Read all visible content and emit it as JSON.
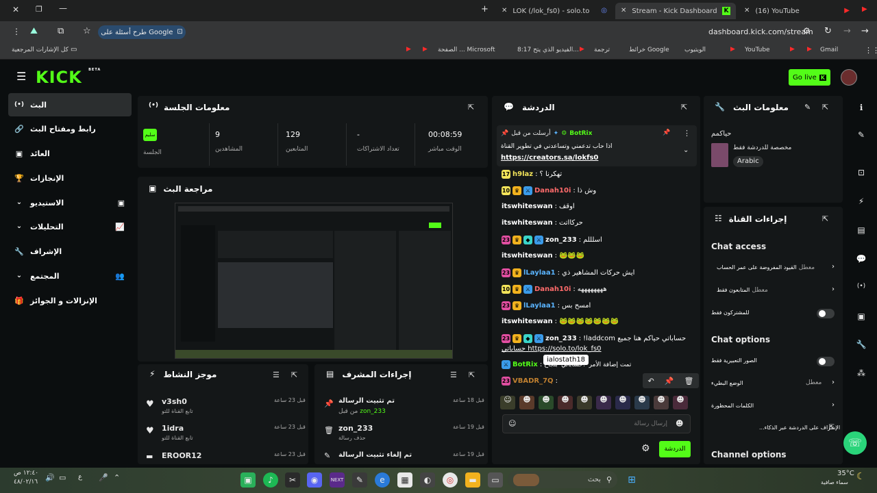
{
  "browser": {
    "tabs": [
      {
        "label": "LOK (/lok_fs0) - solo.to"
      },
      {
        "label": "Stream - Kick Dashboard"
      },
      {
        "label": "(16) YouTube"
      }
    ],
    "url": "dashboard.kick.com/stream",
    "search_pill": "طرح أسئلة على Google",
    "bookmarks": [
      "Gmail",
      "YouTube",
      "الويتيوب",
      "خرائط Google",
      "ترجمة",
      "8:17 الفيديو الذي يتح...",
      "الصفحة ... Microsoft",
      "كل الإشارات المرجعية"
    ]
  },
  "header": {
    "logo": "KICK",
    "logo_badge": "BETA",
    "go_live": "Go live"
  },
  "nav": {
    "items": [
      {
        "label": "البث"
      },
      {
        "label": "رابط ومفتاح البث"
      },
      {
        "label": "العائد"
      },
      {
        "label": "الإنجازات"
      },
      {
        "label": "الاستيديو"
      },
      {
        "label": "التحليلات"
      },
      {
        "label": "الإشراف"
      },
      {
        "label": "المجتمع"
      },
      {
        "label": "الإنزالات و الجوائز"
      }
    ]
  },
  "session": {
    "title": "معلومات الجلسة",
    "health_label": "سليم",
    "health_sub": "الجلسة",
    "stats": [
      {
        "value": "9",
        "label": "المشاهدين"
      },
      {
        "value": "129",
        "label": "المتابعين"
      },
      {
        "value": "-",
        "label": "تعداد الاشتراكات"
      },
      {
        "value": "00:08:59",
        "label": "الوقت مباشر"
      }
    ]
  },
  "preview": {
    "title": "مراجعة البث"
  },
  "activity": {
    "title": "موجز النشاط",
    "items": [
      {
        "user": "v3sh0",
        "action": "تابع القناة للتو",
        "time": "قبل 23 ساعة"
      },
      {
        "user": "1idra",
        "action": "تابع القناة للتو",
        "time": "قبل 23 ساعة"
      },
      {
        "user": "EROOR12",
        "action": "",
        "time": "قبل 23 ساعة"
      }
    ]
  },
  "modactions": {
    "title": "إجراءات المشرف",
    "items": [
      {
        "title": "تم تثبيت الرسالة",
        "sub_prefix": "من قبل ",
        "sub_user": "zon_233",
        "time": "قبل 18 ساعة"
      },
      {
        "title": "zon_233",
        "sub_prefix": "حذف رسالة",
        "sub_user": "",
        "time": "قبل 19 ساعة"
      },
      {
        "title": "تم إلغاء تثبيت الرسالة",
        "sub_prefix": "",
        "sub_user": "",
        "time": "قبل 19 ساعة"
      }
    ]
  },
  "chat": {
    "title": "الدردشة",
    "pinned": {
      "by": "أرسلت من قبل",
      "user": "BotRix",
      "text": "اذا حاب تدعمني وتساعدني في تطوير القناة",
      "link": "https://creators.sa/lokfs0"
    },
    "messages": [
      {
        "user": "h9laz",
        "color": "#f2e35a",
        "text": "تهكرنا ؟"
      },
      {
        "user": "Danah10i",
        "color": "#ff6b6b",
        "text": "وش ذا"
      },
      {
        "user": "itswhiteswan",
        "color": "#ffffff",
        "text": "اوقف"
      },
      {
        "user": "itswhiteswan",
        "color": "#ffffff",
        "text": "حركااتت"
      },
      {
        "user": "zon_233",
        "color": "#ffffff",
        "text": "اسلللم"
      },
      {
        "user": "itswhiteswan",
        "color": "#ffffff",
        "text": "🐸🐸🐸"
      },
      {
        "user": "lLaylaa1",
        "color": "#5ab4ff",
        "text": "ايش حركات المشاهير ذي"
      },
      {
        "user": "Danah10i",
        "color": "#ff6b6b",
        "text": "ههههههههه"
      },
      {
        "user": "lLaylaa1",
        "color": "#5ab4ff",
        "text": "امسح بس"
      },
      {
        "user": "itswhiteswan",
        "color": "#ffffff",
        "text": "🐸🐸🐸🐸🐸🐸🐸"
      },
      {
        "user": "zon_233",
        "color": "#ffffff",
        "text": "!laddcom حساباتي حياكم هنا جميع"
      },
      {
        "user": "",
        "color": "#ffffff",
        "text": "حساباتي https://solo.to/lok_fs0"
      },
      {
        "user": "BotRix",
        "color": "#5aff6a",
        "text": "تمت إضافة الأمر '!حساباتي' بنجاح"
      },
      {
        "user": "VBADR_7Q",
        "color": "#c08030",
        "text": ""
      }
    ],
    "tooltip": "ialostath18",
    "input_placeholder": "إرسال رسالة",
    "send_button": "الدردشة"
  },
  "streaminfo": {
    "title": "معلومات البث",
    "stream_title": "حياكمم",
    "subtitle": "مخصصة للدردشة فقط",
    "language": "Arabic"
  },
  "channel": {
    "title": "إجراءات القناة",
    "chat_access": "Chat access",
    "rows1": [
      {
        "label": "القيود المفروضة على عمر الحساب",
        "value": "معطل"
      },
      {
        "label": "المتابعون فقط",
        "value": "معطل"
      },
      {
        "label": "للمشتركون فقط",
        "value": ""
      }
    ],
    "chat_options": "Chat options",
    "rows2": [
      {
        "label": "الصور التعبيرية فقط",
        "value": ""
      },
      {
        "label": "الوضع البطيء",
        "value": "معطل"
      },
      {
        "label": "الكلمات المحظورة",
        "value": ""
      },
      {
        "label": "...الإشراف على الدردشة عبر الذكاء",
        "value": ""
      }
    ],
    "channel_options": "Channel options"
  },
  "taskbar": {
    "time": "١٢:٤٠ ص",
    "date": "٤٨/٠٢/١٦",
    "search": "بحث",
    "temp": "35°C",
    "weather": "سماء صافية"
  }
}
